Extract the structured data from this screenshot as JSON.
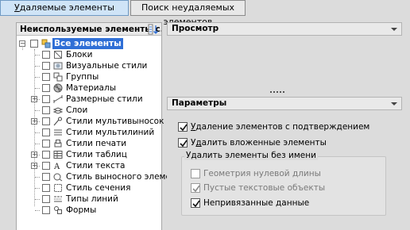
{
  "tabs": [
    {
      "label": "Удаляемые элементы",
      "underline": "У",
      "rest": "даляемые элементы",
      "active": true
    },
    {
      "label": "Поиск неудаляемых элементов",
      "underline": "",
      "rest": "Поиск неудаляемых элементов",
      "active": false
    }
  ],
  "left_panel": {
    "title": "Неиспользуемые элементы с...",
    "sort_icon": "sort-icon",
    "tree": {
      "root": {
        "label": "Все элементы",
        "icon": "items-root-icon",
        "selected": true
      },
      "items": [
        {
          "label": "Блоки",
          "icon": "block-icon",
          "expandable": false
        },
        {
          "label": "Визуальные стили",
          "icon": "visual-style-icon",
          "expandable": false
        },
        {
          "label": "Группы",
          "icon": "group-icon",
          "expandable": false
        },
        {
          "label": "Материалы",
          "icon": "material-icon",
          "expandable": false
        },
        {
          "label": "Размерные стили",
          "icon": "dimension-style-icon",
          "expandable": true
        },
        {
          "label": "Слои",
          "icon": "layers-icon",
          "expandable": false
        },
        {
          "label": "Стили мультивыносок",
          "icon": "multileader-style-icon",
          "expandable": true
        },
        {
          "label": "Стили мультилиний",
          "icon": "multiline-style-icon",
          "expandable": false
        },
        {
          "label": "Стили печати",
          "icon": "plot-style-icon",
          "expandable": false
        },
        {
          "label": "Стили таблиц",
          "icon": "table-style-icon",
          "expandable": true
        },
        {
          "label": "Стили текста",
          "icon": "text-style-icon",
          "expandable": true
        },
        {
          "label": "Стиль выносного элемента",
          "icon": "detail-view-style-icon",
          "expandable": false
        },
        {
          "label": "Стиль сечения",
          "icon": "section-view-style-icon",
          "expandable": false
        },
        {
          "label": "Типы линий",
          "icon": "linetype-icon",
          "expandable": false
        },
        {
          "label": "Формы",
          "icon": "shapes-icon",
          "expandable": false
        }
      ]
    }
  },
  "preview": {
    "title": "Просмотр"
  },
  "params": {
    "title": "Параметры",
    "confirm": {
      "u": "У",
      "rest": "даление элементов с подтверждением",
      "checked": true
    },
    "nested": {
      "pre": "У",
      "u": "д",
      "rest": "алить вложенные элементы",
      "checked": true
    },
    "group_title": "Удалить элементы без имени",
    "zero_geometry": {
      "label": "Геометрия нулевой длины",
      "checked": false,
      "disabled": true
    },
    "empty_text": {
      "label": "Пустые текстовые объекты",
      "checked": true,
      "disabled": true
    },
    "orphaned": {
      "label": "Непривязанные данные",
      "checked": true,
      "disabled": false
    }
  },
  "colors": {
    "accent": "#2f6fd6",
    "active_tab": "#cfe4f7"
  }
}
